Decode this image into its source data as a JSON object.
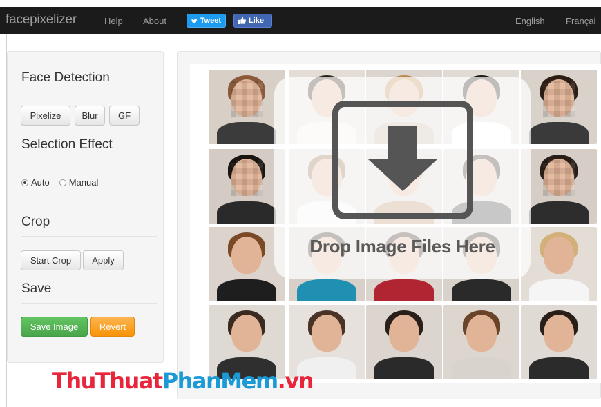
{
  "navbar": {
    "brand": "facepixelizer",
    "links": [
      "Help",
      "About"
    ],
    "tweet_label": "Tweet",
    "like_label": "Like",
    "languages": [
      "English",
      "Françai"
    ]
  },
  "sidebar": {
    "face_detection": {
      "title": "Face Detection",
      "buttons": [
        "Pixelize",
        "Blur",
        "GF"
      ]
    },
    "selection_effect": {
      "title": "Selection Effect",
      "options": [
        "Auto",
        "Manual"
      ],
      "selected": "Auto"
    },
    "crop": {
      "title": "Crop",
      "buttons": [
        "Start Crop",
        "Apply"
      ]
    },
    "save": {
      "title": "Save",
      "save_label": "Save Image",
      "revert_label": "Revert"
    }
  },
  "main": {
    "drop_text": "Drop Image Files Here"
  },
  "watermark": {
    "part1": "ThuThuat",
    "part2": "PhanMem",
    "part3": ".vn"
  },
  "colors": {
    "navbar_bg": "#1b1b1b",
    "save_button": "#5cb85c",
    "revert_button": "#f0ad4e",
    "tweet_button": "#1d9bf0",
    "like_button": "#4267b2"
  }
}
